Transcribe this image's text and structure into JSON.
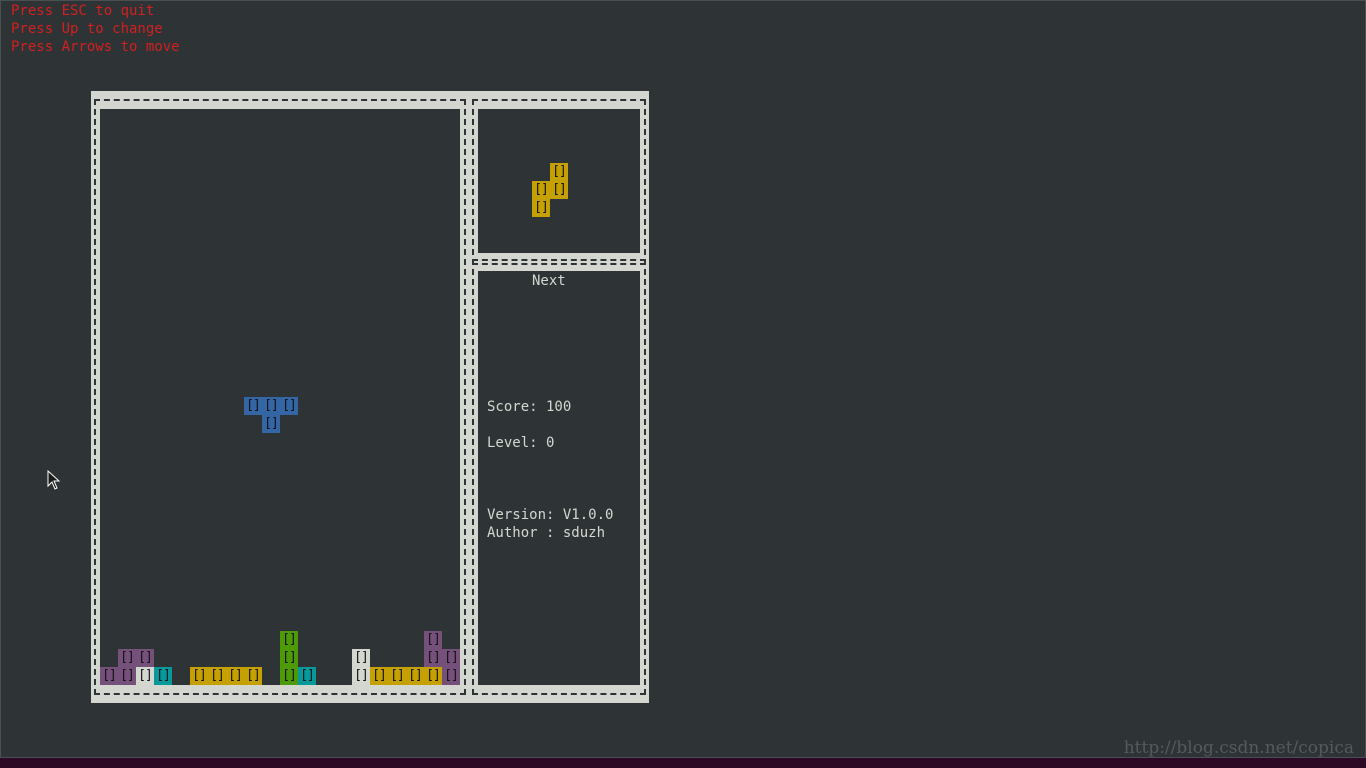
{
  "help": {
    "line1": "Press ESC to quit",
    "line2": "Press Up to change",
    "line3": "Press Arrows to move"
  },
  "block_glyph": "[]",
  "colors": {
    "text_red": "#d21f1f",
    "frame": "#d3d7cf",
    "background": "#2e3436",
    "piece_blue": "#3465a4",
    "piece_yellow": "#c4a000",
    "piece_purple": "#75507b",
    "piece_green": "#4e9a06",
    "piece_cyan": "#06989a",
    "piece_white": "#d3d7cf"
  },
  "panel": {
    "next_label": "Next",
    "score_text": "Score: 100",
    "level_text": "Level: 0",
    "version_text": "Version: V1.0.0",
    "author_text": "Author : sduzh"
  },
  "game": {
    "next_piece": {
      "color": "yellow",
      "cells": [
        [
          1,
          0
        ],
        [
          0,
          1
        ],
        [
          1,
          1
        ],
        [
          0,
          2
        ]
      ]
    },
    "active_piece": {
      "color": "blue",
      "cells": [
        [
          8,
          16
        ],
        [
          9,
          16
        ],
        [
          10,
          16
        ],
        [
          9,
          17
        ]
      ]
    },
    "stack": [
      {
        "col": 1,
        "row": 30,
        "color": "purple"
      },
      {
        "col": 2,
        "row": 30,
        "color": "purple"
      },
      {
        "col": 0,
        "row": 31,
        "color": "purple"
      },
      {
        "col": 1,
        "row": 31,
        "color": "purple"
      },
      {
        "col": 2,
        "row": 31,
        "color": "white"
      },
      {
        "col": 3,
        "row": 31,
        "color": "cyan"
      },
      {
        "col": 5,
        "row": 31,
        "color": "yellow"
      },
      {
        "col": 6,
        "row": 31,
        "color": "yellow"
      },
      {
        "col": 7,
        "row": 31,
        "color": "yellow"
      },
      {
        "col": 8,
        "row": 31,
        "color": "yellow"
      },
      {
        "col": 10,
        "row": 29,
        "color": "green"
      },
      {
        "col": 10,
        "row": 30,
        "color": "green"
      },
      {
        "col": 10,
        "row": 31,
        "color": "green"
      },
      {
        "col": 11,
        "row": 31,
        "color": "cyan"
      },
      {
        "col": 14,
        "row": 30,
        "color": "white"
      },
      {
        "col": 14,
        "row": 31,
        "color": "white"
      },
      {
        "col": 15,
        "row": 31,
        "color": "yellow"
      },
      {
        "col": 16,
        "row": 31,
        "color": "yellow"
      },
      {
        "col": 17,
        "row": 31,
        "color": "yellow"
      },
      {
        "col": 18,
        "row": 31,
        "color": "yellow"
      },
      {
        "col": 18,
        "row": 29,
        "color": "purple"
      },
      {
        "col": 18,
        "row": 30,
        "color": "purple"
      },
      {
        "col": 19,
        "row": 30,
        "color": "purple"
      },
      {
        "col": 19,
        "row": 31,
        "color": "purple"
      }
    ]
  },
  "watermark": "http://blog.csdn.net/copica"
}
